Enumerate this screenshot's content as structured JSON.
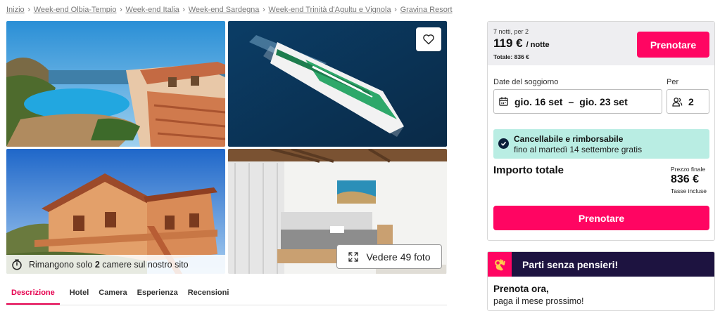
{
  "breadcrumb": [
    "Inizio",
    "Week-end Olbia-Tempio",
    "Week-end Italia",
    "Week-end Sardegna",
    "Week-end Trinità d'Agultu e Vignola",
    "Gravina Resort"
  ],
  "gallery": {
    "rooms_prefix": "Rimangono solo",
    "rooms_count": "2",
    "rooms_suffix": "camere sul nostro sito",
    "see_photos_label": "Vedere 49 foto"
  },
  "tabs": [
    "Descrizione",
    "Hotel",
    "Camera",
    "Esperienza",
    "Recensioni"
  ],
  "booking": {
    "nights_label": "7 notti, per 2",
    "price": "119 €",
    "per_night": "/ notte",
    "total_short": "Totale:  836 €",
    "book_button": "Prenotare",
    "dates_label": "Date del soggiorno",
    "guests_label": "Per",
    "date_from": "gio. 16 set",
    "date_sep": "–",
    "date_to": "gio. 23 set",
    "guests": "2",
    "cancel_title": "Cancellabile e rimborsabile",
    "cancel_sub": "fino al martedì 14 settembre gratis",
    "total_label": "Importo totale",
    "final_label": "Prezzo finale",
    "final_price": "836 €",
    "taxes_label": "Tasse incluse",
    "book_button_2": "Prenotare"
  },
  "promo": {
    "title": "Parti senza pensieri!",
    "line1": "Prenota ora,",
    "line2": "paga il mese prossimo!"
  },
  "colors": {
    "accent": "#ff0562",
    "promo_bg": "#1d1340",
    "cancel_bg": "#b9ede3"
  }
}
